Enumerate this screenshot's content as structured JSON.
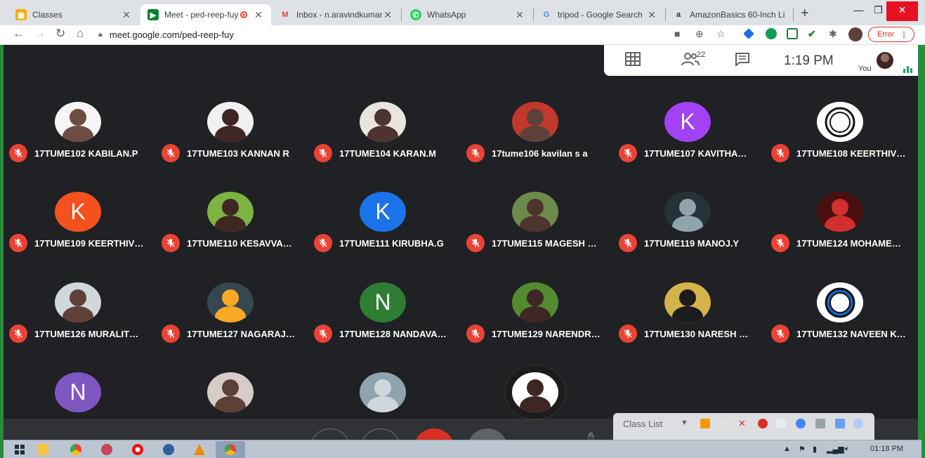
{
  "browser": {
    "tabs": [
      {
        "title": "Classes",
        "fav": "classroom-icon",
        "color": "#f9ab00"
      },
      {
        "title": "Meet - ped-reep-fuy",
        "fav": "meet-icon",
        "color": "#00832d",
        "active": true
      },
      {
        "title": "Inbox - n.aravindkumar@",
        "fav": "gmail-icon",
        "color": "#ea4335"
      },
      {
        "title": "WhatsApp",
        "fav": "whatsapp-icon",
        "color": "#25d366"
      },
      {
        "title": "tripod - Google Search",
        "fav": "google-icon",
        "color": "#4285f4"
      },
      {
        "title": "AmazonBasics 60-Inch Li",
        "fav": "amazon-icon",
        "color": "#232f3e"
      }
    ],
    "url": "meet.google.com/ped-reep-fuy",
    "error_label": "Error"
  },
  "meet": {
    "participant_count": "22",
    "time": "1:19 PM",
    "you_label": "You",
    "participants": [
      {
        "name": "17TUME102 KABILAN.P",
        "avatar": "photo"
      },
      {
        "name": "17TUME103 KANNAN R",
        "avatar": "photo"
      },
      {
        "name": "17TUME104 KARAN.M",
        "avatar": "photo"
      },
      {
        "name": "17tume106 kavilan s a",
        "avatar": "photo"
      },
      {
        "name": "17TUME107 KAVITHA…",
        "avatar": "letter",
        "letter": "K",
        "color": "#a142f4"
      },
      {
        "name": "17TUME108 KEERTHIV…",
        "avatar": "logo"
      },
      {
        "name": "17TUME109 KEERTHIV…",
        "avatar": "letter",
        "letter": "K",
        "color": "#f4511e"
      },
      {
        "name": "17TUME110 KESAVVA…",
        "avatar": "photo"
      },
      {
        "name": "17TUME111 KIRUBHA.G",
        "avatar": "letter",
        "letter": "K",
        "color": "#1a73e8"
      },
      {
        "name": "17TUME115 MAGESH …",
        "avatar": "photo"
      },
      {
        "name": "17TUME119 MANOJ.Y",
        "avatar": "photo"
      },
      {
        "name": "17TUME124 MOHAME…",
        "avatar": "photo"
      },
      {
        "name": "17TUME126 MURALIT…",
        "avatar": "photo"
      },
      {
        "name": "17TUME127 NAGARAJ…",
        "avatar": "photo"
      },
      {
        "name": "17TUME128 NANDAVA…",
        "avatar": "letter",
        "letter": "N",
        "color": "#2e7d32"
      },
      {
        "name": "17TUME129 NARENDR…",
        "avatar": "photo"
      },
      {
        "name": "17TUME130 NARESH …",
        "avatar": "photo"
      },
      {
        "name": "17TUME132 NAVEEN K…",
        "avatar": "logo"
      },
      {
        "name": "",
        "avatar": "letter",
        "letter": "N",
        "color": "#7e57c2"
      },
      {
        "name": "",
        "avatar": "photo"
      },
      {
        "name": "",
        "avatar": "photo"
      },
      {
        "name": "",
        "avatar": "photo"
      }
    ],
    "class_list_label": "Class List"
  },
  "taskbar": {
    "clock": "01:18 PM"
  }
}
